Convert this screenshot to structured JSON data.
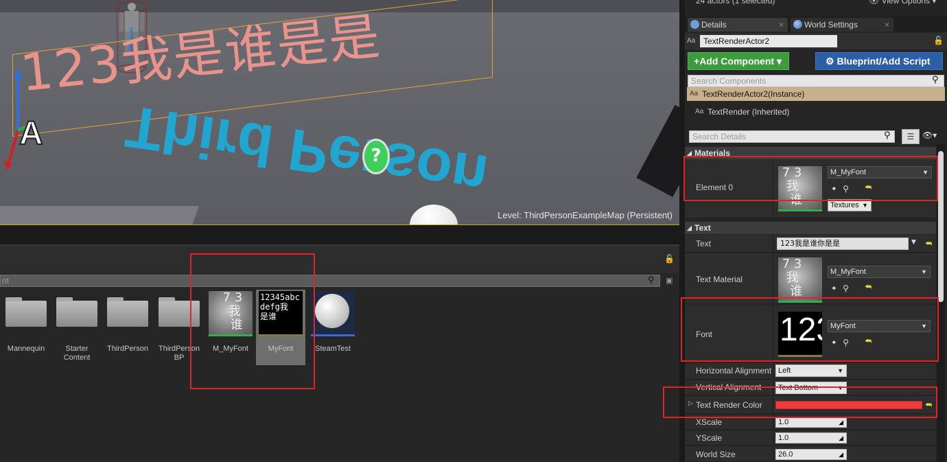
{
  "viewport": {
    "world_text": "123我是谁是是",
    "floor_text": "Third Person",
    "gizmo_letter": "A",
    "qmark": "?",
    "level_prefix": "Level:",
    "level_name": "ThirdPersonExampleMap (Persistent)"
  },
  "content_browser": {
    "search_placeholder": "nt",
    "assets": [
      {
        "label": "Mannequin",
        "kind": "folder"
      },
      {
        "label": "Starter Content",
        "kind": "folder"
      },
      {
        "label": "ThirdPerson",
        "kind": "folder"
      },
      {
        "label": "ThirdPerson BP",
        "kind": "folder"
      },
      {
        "label": "M_MyFont",
        "kind": "material"
      },
      {
        "label": "MyFont",
        "kind": "font",
        "preview": "12345abc defg我 是谁"
      },
      {
        "label": "SteamTest",
        "kind": "sphere"
      }
    ]
  },
  "outliner": {
    "actor_count": "24 actors (1 selected)",
    "view_options": "View Options"
  },
  "tabs": [
    {
      "label": "Details"
    },
    {
      "label": "World Settings"
    }
  ],
  "details": {
    "actor_name": "TextRenderActor2",
    "add_component": "Add Component",
    "blueprint_script": "Blueprint/Add Script",
    "search_components_placeholder": "Search Components",
    "components": [
      {
        "label": "TextRenderActor2(Instance)"
      },
      {
        "label": "TextRender (Inherited)"
      }
    ],
    "search_details_placeholder": "Search Details",
    "sections": {
      "materials": "Materials",
      "text": "Text"
    },
    "element0": {
      "label": "Element 0",
      "value": "M_MyFont",
      "textures": "Textures"
    },
    "text_value": {
      "label": "Text",
      "value": "123我是谁你是是"
    },
    "text_material": {
      "label": "Text Material",
      "value": "M_MyFont"
    },
    "font": {
      "label": "Font",
      "value": "MyFont",
      "preview": "123"
    },
    "h_align": {
      "label": "Horizontal Alignment",
      "value": "Left"
    },
    "v_align": {
      "label": "Vertical Alignment",
      "value": "Text Bottom"
    },
    "render_color": {
      "label": "Text Render Color",
      "color": "#ef3b3b"
    },
    "xscale": {
      "label": "XScale",
      "value": "1.0"
    },
    "yscale": {
      "label": "YScale",
      "value": "1.0"
    },
    "world_size": {
      "label": "World Size",
      "value": "26.0"
    }
  }
}
